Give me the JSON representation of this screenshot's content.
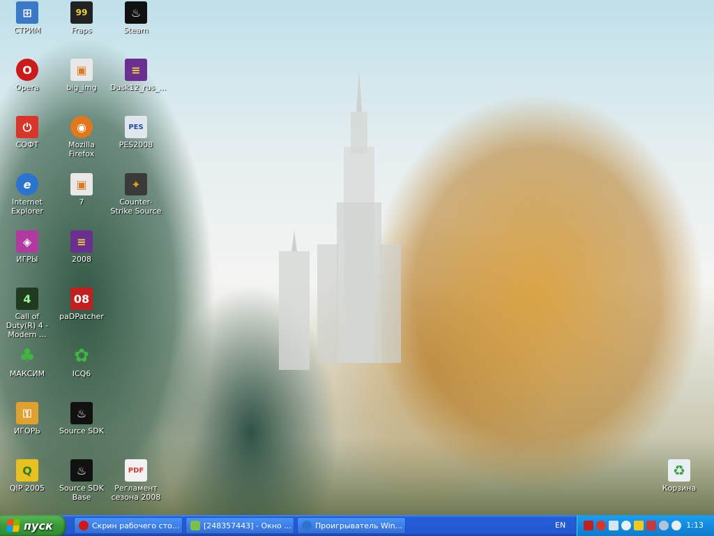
{
  "desktop": {
    "icons": [
      {
        "label": "СТРИМ",
        "color": "#3a78c8",
        "glyph": "⊞"
      },
      {
        "label": "Fraps",
        "color": "#222222",
        "glyph": "99"
      },
      {
        "label": "Steam",
        "color": "#111111",
        "glyph": "♨"
      },
      {
        "label": "Opera",
        "color": "#cc1a1a",
        "glyph": "O"
      },
      {
        "label": "big_img",
        "color": "#e8e8e8",
        "glyph": "▣"
      },
      {
        "label": "Dusk12_rus_...",
        "color": "#6a2f8f",
        "glyph": "≡"
      },
      {
        "label": "СОФТ",
        "color": "#d8362a",
        "glyph": "⏻"
      },
      {
        "label": "Mozilla Firefox",
        "color": "#e2771c",
        "glyph": "◉"
      },
      {
        "label": "PES2008",
        "color": "#dfe6ee",
        "glyph": "PES"
      },
      {
        "label": "Internet Explorer",
        "color": "#2a74d0",
        "glyph": "e"
      },
      {
        "label": "7",
        "color": "#e8e8e8",
        "glyph": "▣"
      },
      {
        "label": "Counter-Strike Source",
        "color": "#3a3a3a",
        "glyph": "✦"
      },
      {
        "label": "ИГРЫ",
        "color": "#b03aa0",
        "glyph": "◈"
      },
      {
        "label": "2008",
        "color": "#6a2f8f",
        "glyph": "≡"
      },
      {
        "label": "Call of Duty(R) 4 - Modern ...",
        "color": "#1f3a1f",
        "glyph": "4"
      },
      {
        "label": "paDPatcher",
        "color": "#c41f1f",
        "glyph": "08"
      },
      {
        "label": "МАКСИМ",
        "color": "#2f8a2f",
        "glyph": "♣"
      },
      {
        "label": "ICQ6",
        "color": "#3fb83f",
        "glyph": "✿"
      },
      {
        "label": "ИГОРЬ",
        "color": "#e0a030",
        "glyph": "⚿"
      },
      {
        "label": "Source SDK",
        "color": "#111111",
        "glyph": "♨"
      },
      {
        "label": "QIP 2005",
        "color": "#e8c020",
        "glyph": "Q"
      },
      {
        "label": "Source SDK Base",
        "color": "#111111",
        "glyph": "♨"
      },
      {
        "label": "Регламент сезона 2008",
        "color": "#d8362a",
        "glyph": "PDF"
      },
      {
        "label": "Корзина",
        "color": "#5fae5f",
        "glyph": "♻"
      }
    ]
  },
  "taskbar": {
    "start_label": "пуск",
    "tasks": [
      {
        "label": "Скрин рабочего сто...",
        "color": "#cc1a1a"
      },
      {
        "label": "[248357443] - Окно ...",
        "color": "#7cc04a"
      },
      {
        "label": "Проигрыватель Win...",
        "color": "#2a74d0"
      }
    ],
    "language": "EN",
    "clock": "1:13",
    "tray_icons": [
      "antivirus-icon",
      "network-icon",
      "volume-icon",
      "search-icon",
      "warning-icon",
      "security-icon",
      "display-icon",
      "info-icon"
    ]
  }
}
